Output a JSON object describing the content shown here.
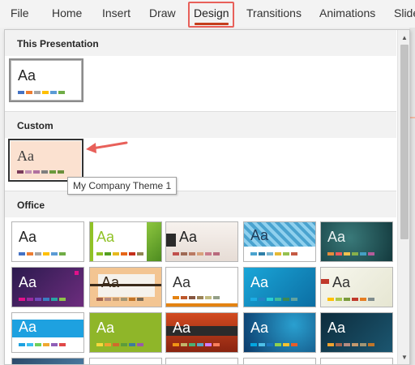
{
  "ribbon": {
    "tabs": [
      {
        "label": "File"
      },
      {
        "label": "Home"
      },
      {
        "label": "Insert"
      },
      {
        "label": "Draw"
      },
      {
        "label": "Design",
        "active": true
      },
      {
        "label": "Transitions"
      },
      {
        "label": "Animations"
      },
      {
        "label": "Slide"
      }
    ]
  },
  "gallery": {
    "sections": [
      {
        "title": "This Presentation"
      },
      {
        "title": "Custom"
      },
      {
        "title": "Office"
      }
    ],
    "thumb_text": "Aa",
    "tooltip": "My Company Theme 1"
  },
  "colors": {
    "accent": "#c43e1c",
    "highlight_outline": "#e8605a",
    "annotation_arrow": "#e8605a",
    "custom_theme_bg": "#fbe1d0"
  }
}
